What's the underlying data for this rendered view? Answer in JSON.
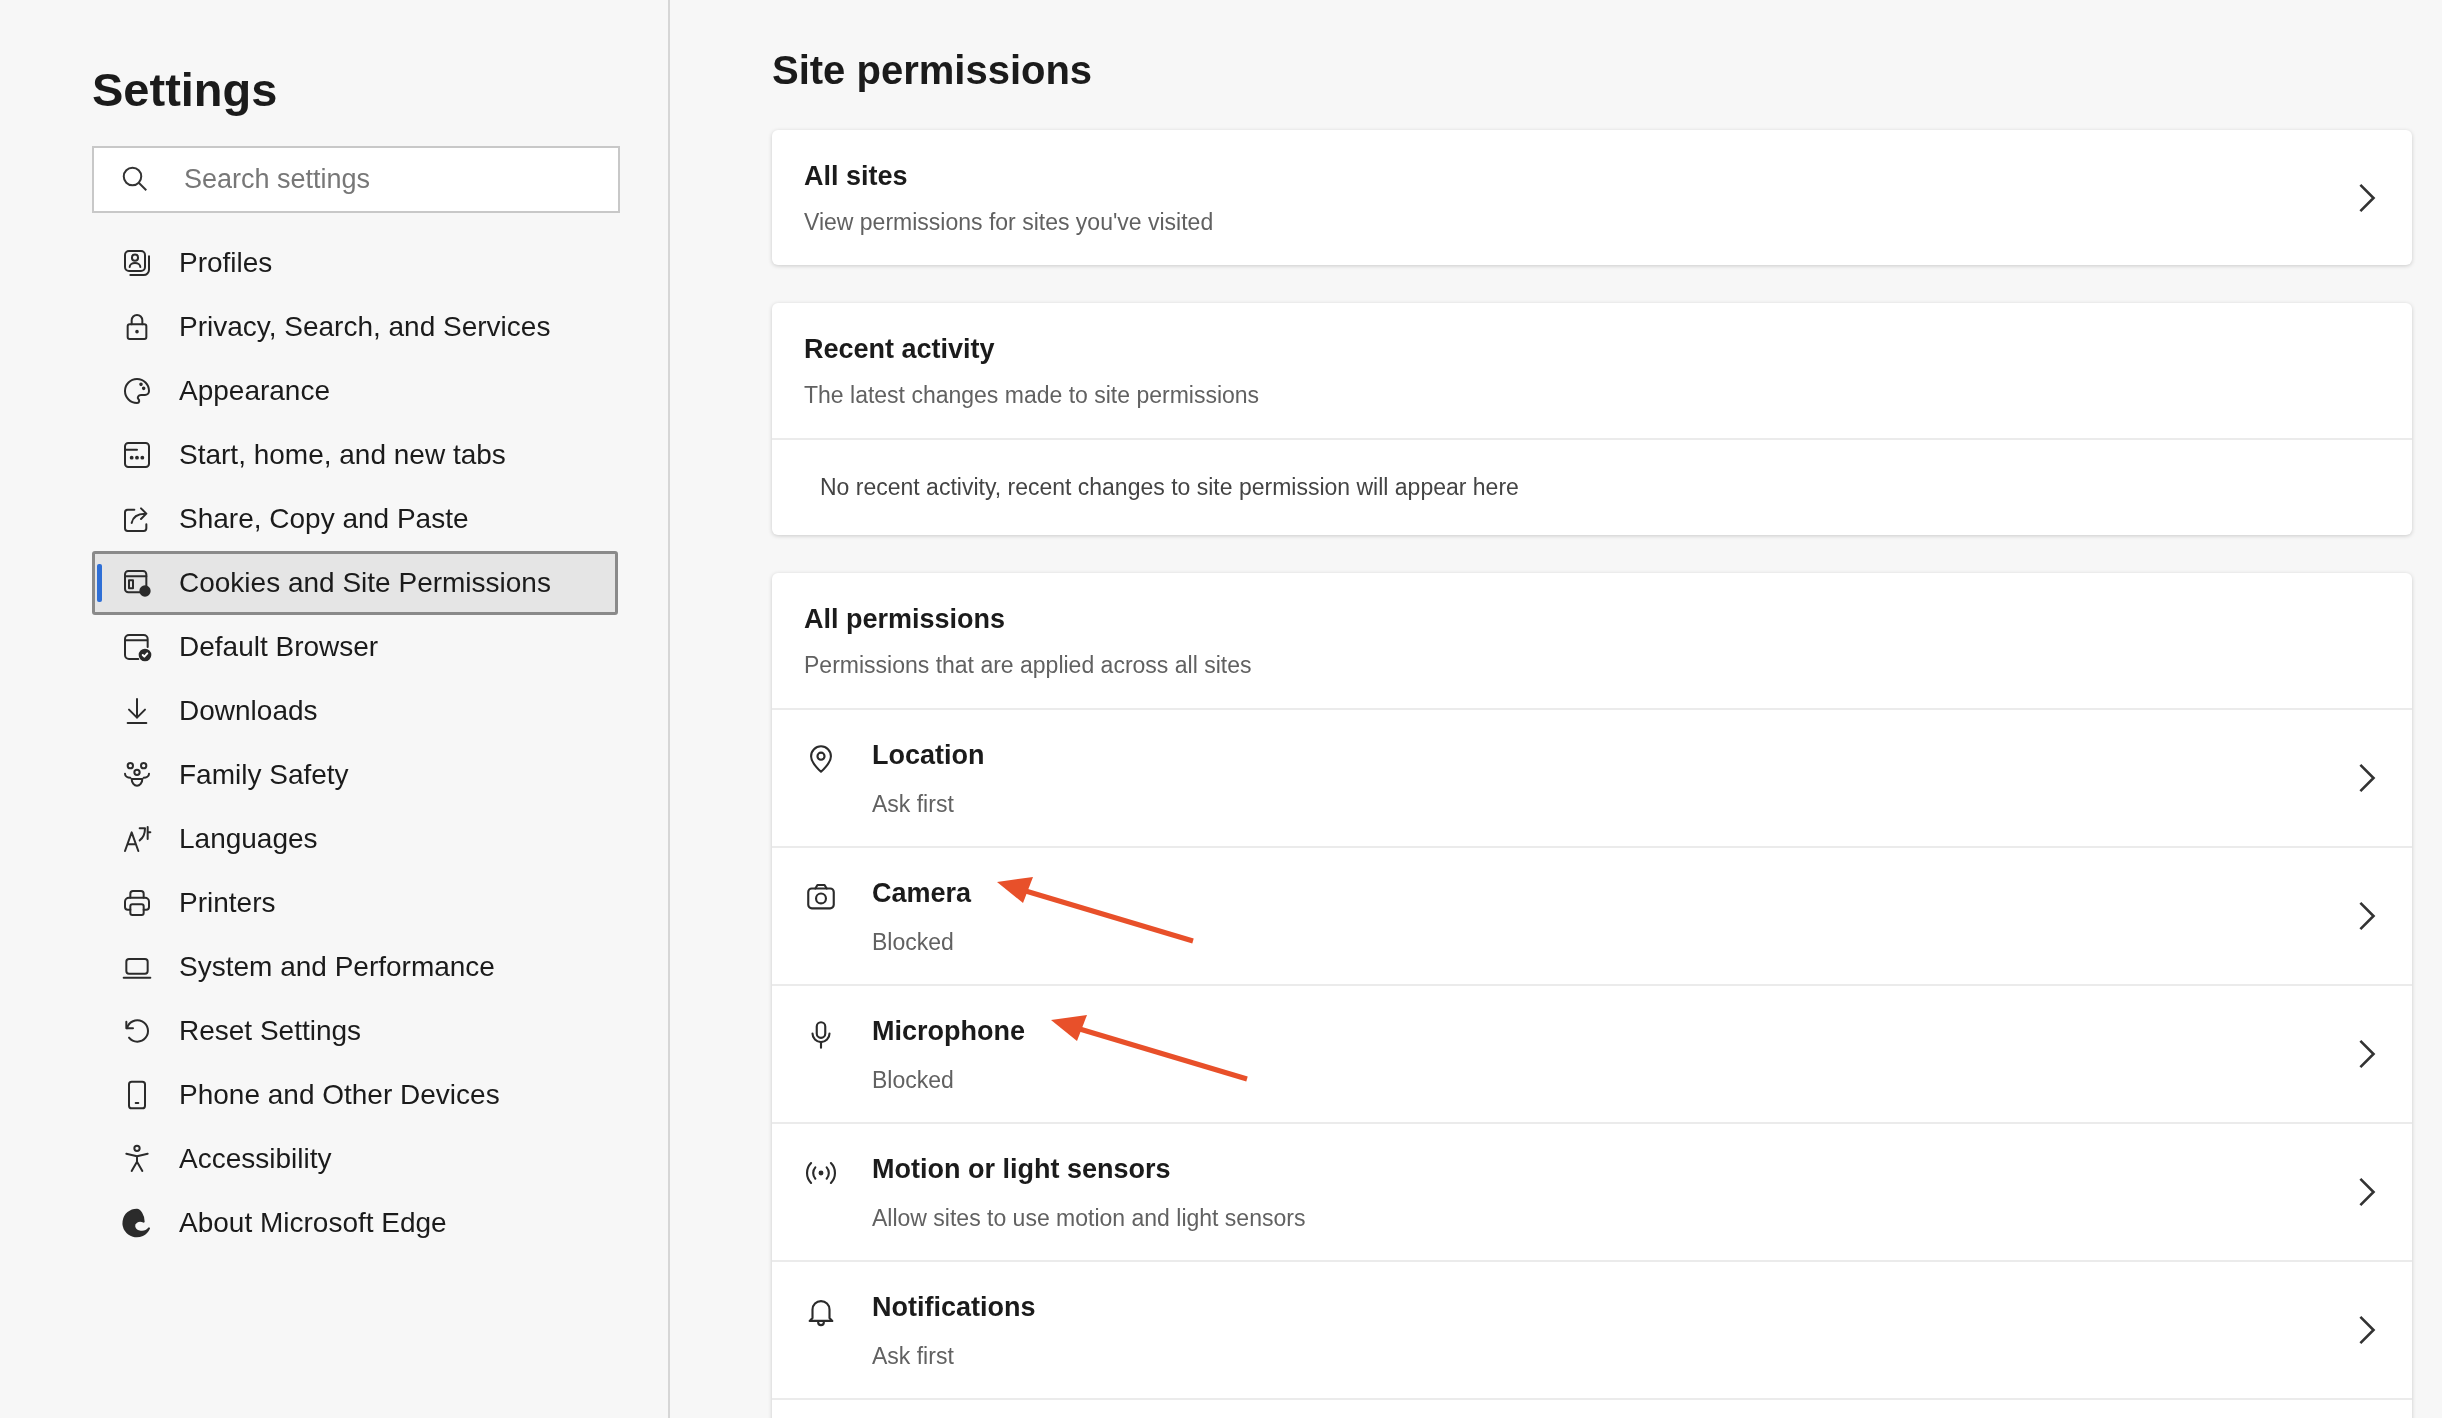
{
  "sidebar": {
    "title": "Settings",
    "search": {
      "placeholder": "Search settings"
    },
    "items": [
      {
        "label": "Profiles",
        "selected": false
      },
      {
        "label": "Privacy, Search, and Services",
        "selected": false
      },
      {
        "label": "Appearance",
        "selected": false
      },
      {
        "label": "Start, home, and new tabs",
        "selected": false
      },
      {
        "label": "Share, Copy and Paste",
        "selected": false
      },
      {
        "label": "Cookies and Site Permissions",
        "selected": true
      },
      {
        "label": "Default Browser",
        "selected": false
      },
      {
        "label": "Downloads",
        "selected": false
      },
      {
        "label": "Family Safety",
        "selected": false
      },
      {
        "label": "Languages",
        "selected": false
      },
      {
        "label": "Printers",
        "selected": false
      },
      {
        "label": "System and Performance",
        "selected": false
      },
      {
        "label": "Reset Settings",
        "selected": false
      },
      {
        "label": "Phone and Other Devices",
        "selected": false
      },
      {
        "label": "Accessibility",
        "selected": false
      },
      {
        "label": "About Microsoft Edge",
        "selected": false
      }
    ]
  },
  "main": {
    "title": "Site permissions",
    "all_sites": {
      "title": "All sites",
      "subtitle": "View permissions for sites you've visited"
    },
    "recent_activity": {
      "title": "Recent activity",
      "subtitle": "The latest changes made to site permissions",
      "empty_message": "No recent activity, recent changes to site permission will appear here"
    },
    "all_permissions": {
      "title": "All permissions",
      "subtitle": "Permissions that are applied across all sites",
      "items": [
        {
          "title": "Location",
          "subtitle": "Ask first",
          "arrow": false
        },
        {
          "title": "Camera",
          "subtitle": "Blocked",
          "arrow": true
        },
        {
          "title": "Microphone",
          "subtitle": "Blocked",
          "arrow": true
        },
        {
          "title": "Motion or light sensors",
          "subtitle": "Allow sites to use motion and light sensors",
          "arrow": false
        },
        {
          "title": "Notifications",
          "subtitle": "Ask first",
          "arrow": false
        }
      ]
    }
  }
}
